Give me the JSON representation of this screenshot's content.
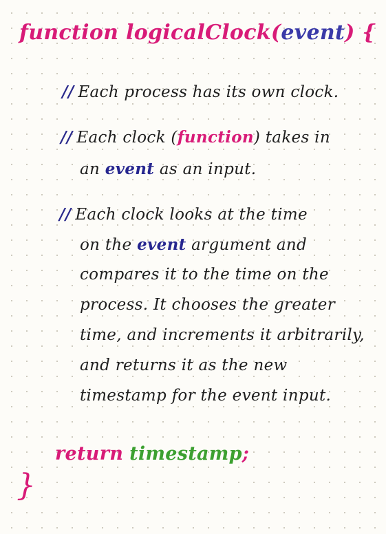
{
  "header": {
    "keyword": "function",
    "name": "logicalClock",
    "open_paren": "(",
    "param": "event",
    "close_paren": ")",
    "open_brace": "{"
  },
  "comments": [
    {
      "slash": "//",
      "lines": [
        {
          "text": "Each process has its own clock."
        }
      ]
    },
    {
      "slash": "//",
      "lines": [
        {
          "pre": "Each clock (",
          "highlight": "function",
          "post": ") takes in"
        },
        {
          "pre": "an ",
          "highlight": "event",
          "post": " as an input."
        }
      ]
    },
    {
      "slash": "//",
      "lines": [
        {
          "text": "Each clock looks at the time"
        },
        {
          "pre": "on the ",
          "highlight": "event",
          "post": " argument and"
        },
        {
          "text": "compares it to the time on the"
        },
        {
          "text": "process. It chooses the greater"
        },
        {
          "text": "time, and increments it arbitrarily,"
        },
        {
          "text": "and returns it as the new"
        },
        {
          "text": "timestamp for the event input."
        }
      ]
    }
  ],
  "return_stmt": {
    "keyword": "return",
    "value": "timestamp",
    "semicolon": ";"
  },
  "closing_brace": "}",
  "colors": {
    "pink": "#d81b78",
    "blue": "#26268f",
    "green": "#3ca030",
    "ink": "#1e1e1e"
  }
}
